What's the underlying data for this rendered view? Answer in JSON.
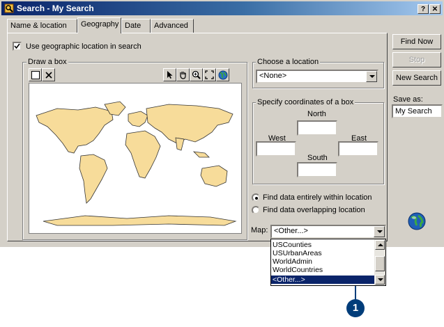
{
  "window": {
    "title": "Search - My Search",
    "help_button": "?",
    "close_button": "✕"
  },
  "tabs": [
    {
      "label": "Name & location",
      "active": false
    },
    {
      "label": "Geography",
      "active": true
    },
    {
      "label": "Date",
      "active": false
    },
    {
      "label": "Advanced",
      "active": false
    }
  ],
  "geography": {
    "use_geo_label": "Use geographic location in search",
    "use_geo_checked": true,
    "draw_box_label": "Draw a box",
    "tools": [
      "box-select-icon",
      "clear-icon",
      "pointer-icon",
      "pan-hand-icon",
      "zoom-in-icon",
      "full-extent-icon",
      "globe-icon"
    ],
    "choose_location_label": "Choose a location",
    "location_value": "<None>",
    "specify_coords_label": "Specify coordinates of a box",
    "north_label": "North",
    "west_label": "West",
    "east_label": "East",
    "south_label": "South",
    "north_value": "",
    "west_value": "",
    "east_value": "",
    "south_value": "",
    "radio_within_label": "Find data entirely within location",
    "radio_overlap_label": "Find data overlapping location",
    "radio_selected": "within",
    "map_label": "Map:",
    "map_value": "<Other...>",
    "map_options": [
      "USCounties",
      "USUrbanAreas",
      "WorldAdmin",
      "WorldCountries",
      "<Other...>"
    ],
    "map_selected_index": 4
  },
  "side": {
    "find_now": "Find Now",
    "stop": "Stop",
    "new_search": "New Search",
    "save_as_label": "Save as:",
    "save_as_value": "My Search"
  },
  "callout": {
    "number": "1",
    "color": "#003d7a"
  },
  "colors": {
    "land": "#f7dc9a",
    "titlebar": "#0a246a",
    "selection": "#0a246a"
  }
}
